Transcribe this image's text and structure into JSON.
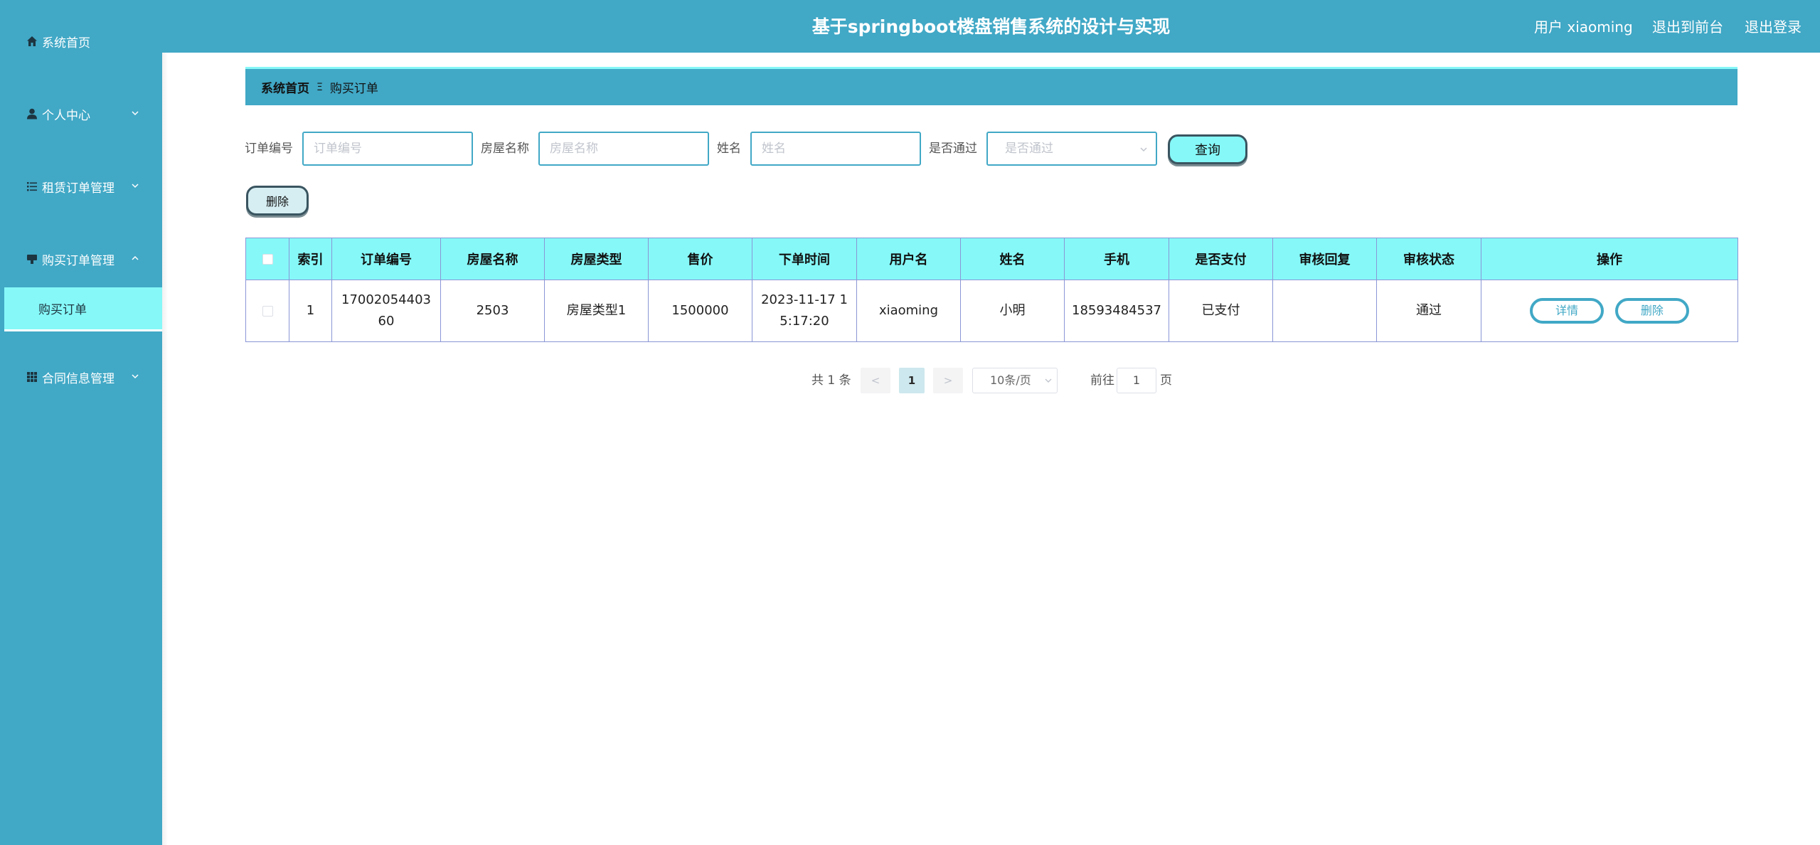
{
  "header": {
    "title": "基于springboot楼盘销售系统的设计与实现",
    "user": "用户 xiaoming",
    "to_front": "退出到前台",
    "logout": "退出登录"
  },
  "sidebar": {
    "items": [
      {
        "label": "系统首页",
        "icon": "home-icon"
      },
      {
        "label": "个人中心",
        "icon": "user-icon"
      },
      {
        "label": "租赁订单管理",
        "icon": "list-icon"
      },
      {
        "label": "购买订单管理",
        "icon": "cart-icon"
      },
      {
        "label": "合同信息管理",
        "icon": "grid-icon"
      }
    ],
    "sub_item": "购买订单"
  },
  "breadcrumb": {
    "home": "系统首页",
    "current": "购买订单"
  },
  "search": {
    "order_no_label": "订单编号",
    "order_no_placeholder": "订单编号",
    "house_name_label": "房屋名称",
    "house_name_placeholder": "房屋名称",
    "name_label": "姓名",
    "name_placeholder": "姓名",
    "approved_label": "是否通过",
    "approved_placeholder": "是否通过",
    "query_button": "查询"
  },
  "actions": {
    "delete_button": "删除"
  },
  "table": {
    "headers": [
      "索引",
      "订单编号",
      "房屋名称",
      "房屋类型",
      "售价",
      "下单时间",
      "用户名",
      "姓名",
      "手机",
      "是否支付",
      "审核回复",
      "审核状态",
      "操作"
    ],
    "rows": [
      {
        "index": "1",
        "order_no": "1700205440360",
        "house_name": "2503",
        "house_type": "房屋类型1",
        "price": "1500000",
        "order_time": "2023-11-17 15:17:20",
        "username": "xiaoming",
        "name": "小明",
        "phone": "18593484537",
        "paid": "已支付",
        "review_reply": "",
        "review_status": "通过",
        "detail_button": "详情",
        "delete_button": "删除"
      }
    ]
  },
  "pagination": {
    "total": "共 1 条",
    "prev": "<",
    "current": "1",
    "next": ">",
    "page_size": "10条/页",
    "goto_label": "前往",
    "goto_value": "1",
    "page_unit": "页"
  },
  "colors": {
    "primary": "#41a8c6",
    "accent": "#86f8f8"
  }
}
